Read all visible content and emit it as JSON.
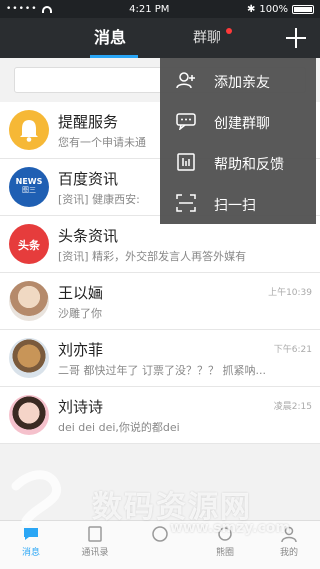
{
  "status_bar": {
    "time": "4:21 PM",
    "battery": "100%",
    "carrier_dots": "•••••"
  },
  "nav": {
    "tab_messages": "消息",
    "tab_groups": "群聊"
  },
  "conversations": [
    {
      "name": "提醒服务",
      "preview": "您有一个申请未通",
      "time": ""
    },
    {
      "name": "百度资讯",
      "preview": "[资讯] 健康西安:",
      "time": ""
    },
    {
      "name": "头条资讯",
      "preview": "[资讯] 精彩，外交部发言人再答外媒有",
      "time": ""
    },
    {
      "name": "王以婳",
      "preview": "沙雕了你",
      "time": "上午10:39"
    },
    {
      "name": "刘亦菲",
      "preview": "二哥 都快过年了 订票了没？？？ 抓紧呐...",
      "time": "下午6:21"
    },
    {
      "name": "刘诗诗",
      "preview": "dei dei dei,你说的都dei",
      "time": "凌晨2:15"
    }
  ],
  "avatar_labels": {
    "news_en": "NEWS",
    "news_cn": "图三",
    "toutiao": "头条"
  },
  "menu": [
    {
      "label": "添加亲友",
      "icon": "add-friend-icon"
    },
    {
      "label": "创建群聊",
      "icon": "group-chat-icon"
    },
    {
      "label": "帮助和反馈",
      "icon": "help-feedback-icon"
    },
    {
      "label": "扫一扫",
      "icon": "scan-icon"
    }
  ],
  "tabbar": [
    {
      "label": "消息"
    },
    {
      "label": "通讯录"
    },
    {
      "label": ""
    },
    {
      "label": "熊圈"
    },
    {
      "label": "我的"
    }
  ],
  "watermark": {
    "text": "数码资源网",
    "url": "www.smzy.com"
  },
  "colors": {
    "accent": "#2aa6f5",
    "nav_bg": "#2a2d30",
    "menu_bg": "#535353",
    "badge": "#ff3a3a"
  }
}
